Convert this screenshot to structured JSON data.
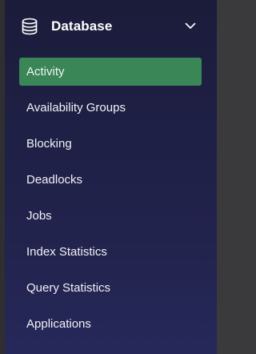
{
  "sidebar": {
    "section": {
      "title": "Database",
      "icon": "database-icon",
      "toggle_icon": "chevron-down-icon",
      "expanded": true
    },
    "items": [
      {
        "label": "Activity",
        "active": true
      },
      {
        "label": "Availability Groups",
        "active": false
      },
      {
        "label": "Blocking",
        "active": false
      },
      {
        "label": "Deadlocks",
        "active": false
      },
      {
        "label": "Jobs",
        "active": false
      },
      {
        "label": "Index Statistics",
        "active": false
      },
      {
        "label": "Query Statistics",
        "active": false
      },
      {
        "label": "Applications",
        "active": false
      }
    ]
  },
  "colors": {
    "sidebar_bg_top": "#1b1c3a",
    "sidebar_bg_bottom": "#26285a",
    "active_item_bg": "#3a8656",
    "text": "#ffffff"
  }
}
